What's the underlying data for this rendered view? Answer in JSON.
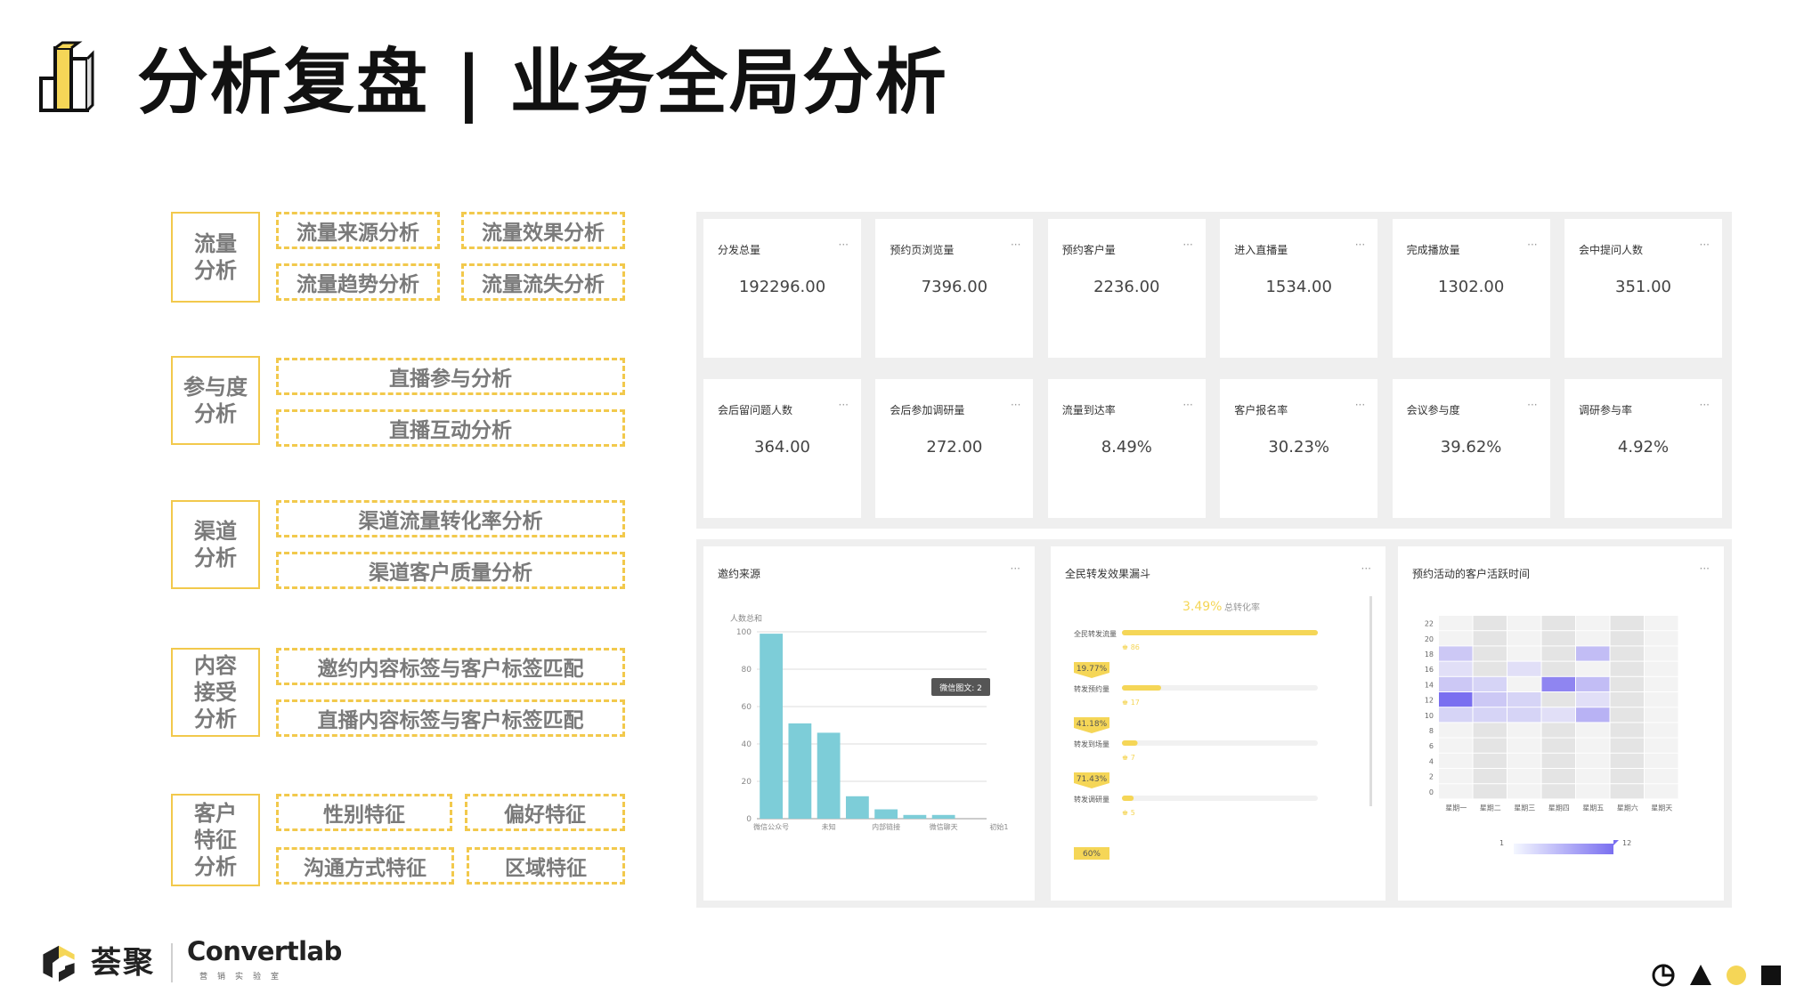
{
  "title": "分析复盘 | 业务全局分析",
  "colors": {
    "accent": "#f2c94c",
    "teal": "#7dcdd8",
    "funnel": "#f5d657",
    "heat": "#7a6ff0"
  },
  "framework": [
    {
      "category": "流量\n分析",
      "items": [
        "流量来源分析",
        "流量效果分析",
        "流量趋势分析",
        "流量流失分析"
      ]
    },
    {
      "category": "参与度\n分析",
      "items": [
        "直播参与分析",
        "直播互动分析"
      ]
    },
    {
      "category": "渠道\n分析",
      "items": [
        "渠道流量转化率分析",
        "渠道客户质量分析"
      ]
    },
    {
      "category": "内容\n接受\n分析",
      "items": [
        "邀约内容标签与客户标签匹配",
        "直播内容标签与客户标签匹配"
      ]
    },
    {
      "category": "客户\n特征\n分析",
      "items": [
        "性别特征",
        "偏好特征",
        "沟通方式特征",
        "区域特征"
      ]
    }
  ],
  "kpis": [
    {
      "label": "分发总量",
      "value": "192296.00"
    },
    {
      "label": "预约页浏览量",
      "value": "7396.00"
    },
    {
      "label": "预约客户量",
      "value": "2236.00"
    },
    {
      "label": "进入直播量",
      "value": "1534.00"
    },
    {
      "label": "完成播放量",
      "value": "1302.00"
    },
    {
      "label": "会中提问人数",
      "value": "351.00"
    },
    {
      "label": "会后留问题人数",
      "value": "364.00"
    },
    {
      "label": "会后参加调研量",
      "value": "272.00"
    },
    {
      "label": "流量到达率",
      "value": "8.49%"
    },
    {
      "label": "客户报名率",
      "value": "30.23%"
    },
    {
      "label": "会议参与度",
      "value": "39.62%"
    },
    {
      "label": "调研参与率",
      "value": "4.92%"
    }
  ],
  "menu_dots": "···",
  "cards": {
    "invite": {
      "title": "邀约来源"
    },
    "funnel": {
      "title": "全民转发效果漏斗"
    },
    "heatmap": {
      "title": "预约活动的客户活跃时间"
    }
  },
  "chart_data": [
    {
      "type": "bar",
      "title": "邀约来源",
      "ylabel": "人数总和",
      "ylim": [
        0,
        100
      ],
      "yticks": [
        0,
        20,
        40,
        60,
        80,
        100
      ],
      "categories": [
        "微信公众号",
        "",
        "未知",
        "",
        "内部链接",
        "",
        "微信聊天",
        "初始1"
      ],
      "tick_labels": [
        "微信公众号",
        "未知",
        "内部链接",
        "微信聊天",
        "初始1"
      ],
      "values": [
        99,
        51,
        46,
        12,
        5,
        2,
        2,
        0
      ],
      "tooltip": "微信图文: 2"
    },
    {
      "type": "bar",
      "title": "全民转发效果漏斗",
      "summary": {
        "value": "3.49%",
        "label": "总转化率"
      },
      "stages": [
        {
          "label": "全民转发流量",
          "value": 86,
          "fill": 1.0,
          "rate": ""
        },
        {
          "label": "转发预约量",
          "value": 17,
          "fill": 0.2,
          "rate": "19.77%"
        },
        {
          "label": "转发到场量",
          "value": 7,
          "fill": 0.08,
          "rate": "41.18%"
        },
        {
          "label": "转发调研量",
          "value": 5,
          "fill": 0.06,
          "rate": "71.43%"
        }
      ],
      "last_rate": "60%"
    },
    {
      "type": "heatmap",
      "title": "预约活动的客户活跃时间",
      "x": [
        "星期一",
        "星期二",
        "星期三",
        "星期四",
        "星期五",
        "星期六",
        "星期天"
      ],
      "y": [
        0,
        2,
        4,
        6,
        8,
        10,
        12,
        14,
        16,
        18,
        20,
        22
      ],
      "y_tick_labels": [
        "0",
        "2",
        "4",
        "6",
        "8",
        "10",
        "12",
        "14",
        "16",
        "18",
        "20",
        "22"
      ],
      "visual_map": {
        "min": "1",
        "max": "12"
      },
      "rows": [
        {
          "y": 22,
          "values": [
            0,
            1,
            0,
            1,
            0,
            1,
            0
          ]
        },
        {
          "y": 20,
          "values": [
            0,
            1,
            1,
            0,
            1,
            1,
            0
          ]
        },
        {
          "y": 18,
          "values": [
            4,
            1,
            1,
            0,
            5,
            1,
            0
          ]
        },
        {
          "y": 16,
          "values": [
            2,
            1,
            2,
            1,
            1,
            1,
            0
          ]
        },
        {
          "y": 14,
          "values": [
            4,
            3,
            1,
            10,
            5,
            1,
            0
          ]
        },
        {
          "y": 12,
          "values": [
            12,
            4,
            3,
            1,
            2,
            1,
            0
          ]
        },
        {
          "y": 10,
          "values": [
            3,
            3,
            3,
            2,
            6,
            1,
            0
          ]
        },
        {
          "y": 8,
          "values": [
            1,
            1,
            1,
            1,
            1,
            1,
            0
          ]
        },
        {
          "y": 6,
          "values": [
            0,
            1,
            0,
            1,
            0,
            1,
            0
          ]
        },
        {
          "y": 4,
          "values": [
            0,
            1,
            0,
            1,
            0,
            1,
            0
          ]
        },
        {
          "y": 2,
          "values": [
            0,
            1,
            0,
            1,
            0,
            1,
            0
          ]
        },
        {
          "y": 0,
          "values": [
            0,
            1,
            0,
            1,
            0,
            1,
            0
          ]
        }
      ]
    }
  ],
  "footer": {
    "brand_cn": "荟聚",
    "brand_en": "Convertlab",
    "brand_sub": "营销实验室",
    "shape_icons": [
      "pie-icon",
      "triangle-icon",
      "circle-icon",
      "square-icon"
    ]
  }
}
